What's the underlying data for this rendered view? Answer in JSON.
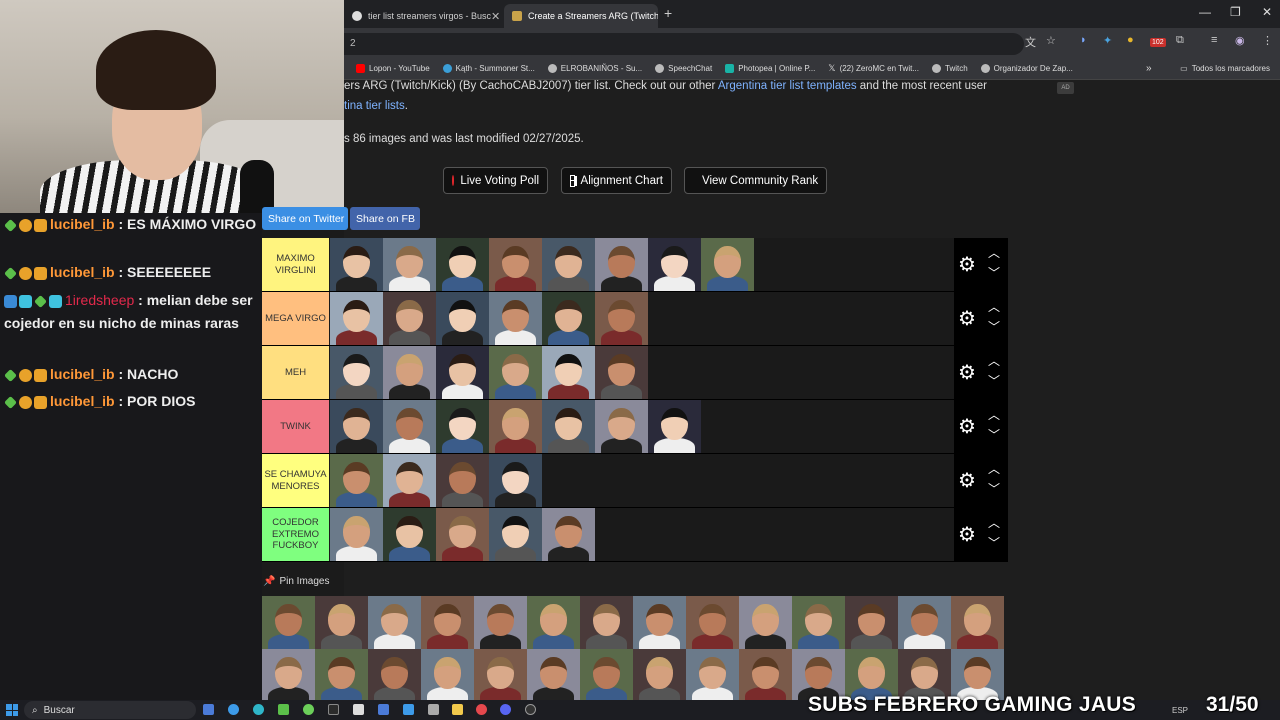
{
  "browser": {
    "tabs": [
      {
        "label": "tier list streamers virgos - Busc"
      },
      {
        "label": "Create a Streamers ARG (Twitch"
      }
    ],
    "address_fragment": "2",
    "bookmarks": [
      "Lopon - YouTube",
      "Kąth - Summoner St...",
      "ELROBANIÑOS - Su...",
      "SpeechChat",
      "Photopea | Online P...",
      "(22) ZeroMC en Twit...",
      "Twitch",
      "Organizador De Zap..."
    ],
    "bookmarks_right": "Todos los marcadores",
    "notification_count": "102"
  },
  "page": {
    "intro_line1_pre": "ers ARG (Twitch/Kick) (By CachoCABJ2007) tier list. Check out our other ",
    "intro_line1_link": "Argentina tier list templates",
    "intro_line1_post": " and the most recent user",
    "intro_line2_link": "tina tier lists",
    "intro_line2_post": ".",
    "intro_line3": "s 86 images and was last modified 02/27/2025.",
    "ad_badge": "AD",
    "buttons": {
      "live_poll": "Live Voting Poll",
      "alignment": "Alignment Chart",
      "community": "View Community Rank"
    },
    "share_twitter": "Share on Twitter",
    "share_fb": "Share on FB",
    "pin_label": "Pin Images"
  },
  "tiers": [
    {
      "label": "MAXIMO VIRGLINI",
      "color": "#fff47f",
      "items": 8
    },
    {
      "label": "MEGA VIRGO",
      "color": "#ffbf7f",
      "items": 6
    },
    {
      "label": "MEH",
      "color": "#ffdf80",
      "items": 6
    },
    {
      "label": "TWINK",
      "color": "#f27885",
      "items": 7
    },
    {
      "label": "SE CHAMUYA MENORES",
      "color": "#ffff7f",
      "items": 4
    },
    {
      "label": "COJEDOR EXTREMO FUCKBOY",
      "color": "#7fff7f",
      "items": 5
    }
  ],
  "pool_count": 28,
  "chat": [
    {
      "user": "lucibel_ib",
      "message": "ES MÁXIMO VIRGO",
      "user_color": "orange"
    },
    {
      "user": "lucibel_ib",
      "message": "SEEEEEEEE",
      "user_color": "orange"
    },
    {
      "user": "1iredsheep",
      "message": "melian debe ser cojedor en su nicho de minas raras",
      "user_color": "red"
    },
    {
      "user": "lucibel_ib",
      "message": "NACHO",
      "user_color": "orange"
    },
    {
      "user": "lucibel_ib",
      "message": "POR DIOS",
      "user_color": "orange"
    }
  ],
  "taskbar": {
    "search_placeholder": "Buscar",
    "ticker": "SUBS FEBRERO GAMING JAUS",
    "counter": "31/50",
    "tray_lang": "ESP"
  }
}
